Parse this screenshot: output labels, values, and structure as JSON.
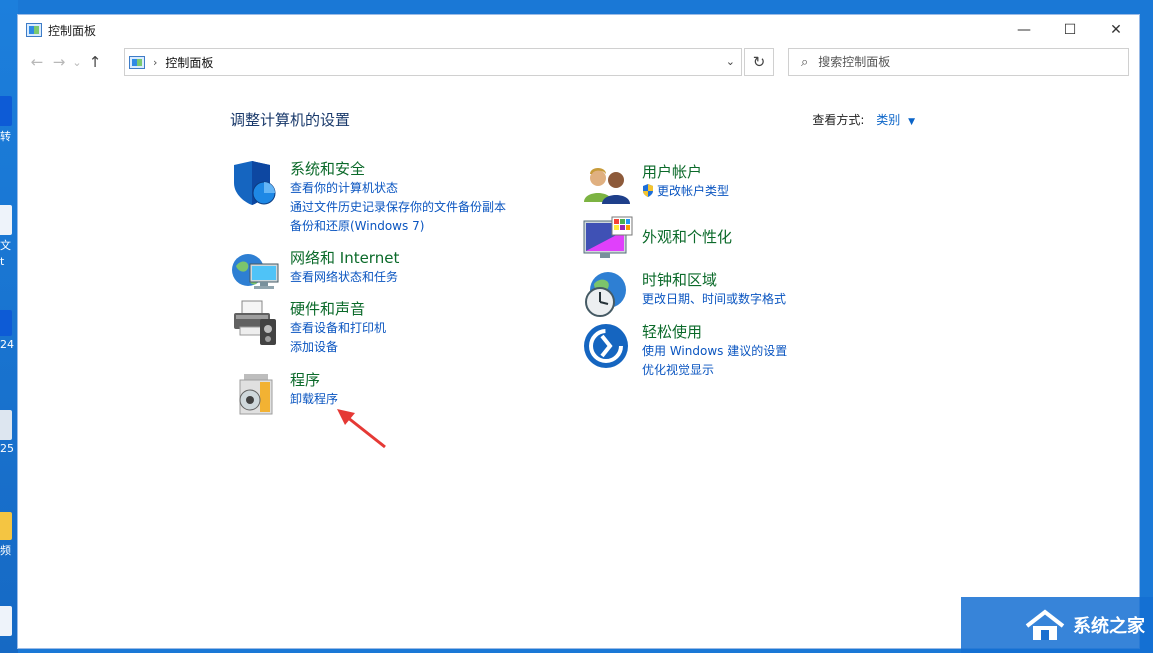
{
  "window": {
    "title": "控制面板",
    "minimize": "—",
    "maximize": "☐",
    "close": "✕"
  },
  "nav": {
    "back": "←",
    "forward": "→",
    "down": "⌄",
    "up": "↑",
    "address": "控制面板",
    "address_sep": "›",
    "address_drop": "⌄",
    "refresh": "↻",
    "search_placeholder": "搜索控制面板",
    "search_icon": "⌕"
  },
  "content": {
    "heading": "调整计算机的设置",
    "view_by_label": "查看方式:",
    "view_by_value": "类别",
    "view_by_caret": "▼"
  },
  "categories_left": [
    {
      "title": "系统和安全",
      "icon": "shield-icon",
      "links": [
        "查看你的计算机状态",
        "通过文件历史记录保存你的文件备份副本",
        "备份和还原(Windows 7)"
      ]
    },
    {
      "title": "网络和 Internet",
      "icon": "network-globe-icon",
      "links": [
        "查看网络状态和任务"
      ]
    },
    {
      "title": "硬件和声音",
      "icon": "printer-speaker-icon",
      "links": [
        "查看设备和打印机",
        "添加设备"
      ]
    },
    {
      "title": "程序",
      "icon": "programs-disc-icon",
      "links": [
        "卸载程序"
      ]
    }
  ],
  "categories_right": [
    {
      "title": "用户帐户",
      "icon": "users-icon",
      "links": [
        "更改帐户类型"
      ]
    },
    {
      "title": "外观和个性化",
      "icon": "monitor-palette-icon",
      "links": []
    },
    {
      "title": "时钟和区域",
      "icon": "clock-globe-icon",
      "links": [
        "更改日期、时间或数字格式"
      ]
    },
    {
      "title": "轻松使用",
      "icon": "ease-of-access-icon",
      "links": [
        "使用 Windows 建议的设置",
        "优化视觉显示"
      ]
    }
  ],
  "desktop": {
    "labels": [
      "转",
      "文",
      "t",
      "24",
      "25",
      "频"
    ]
  },
  "watermark": {
    "text": "系统之家"
  }
}
